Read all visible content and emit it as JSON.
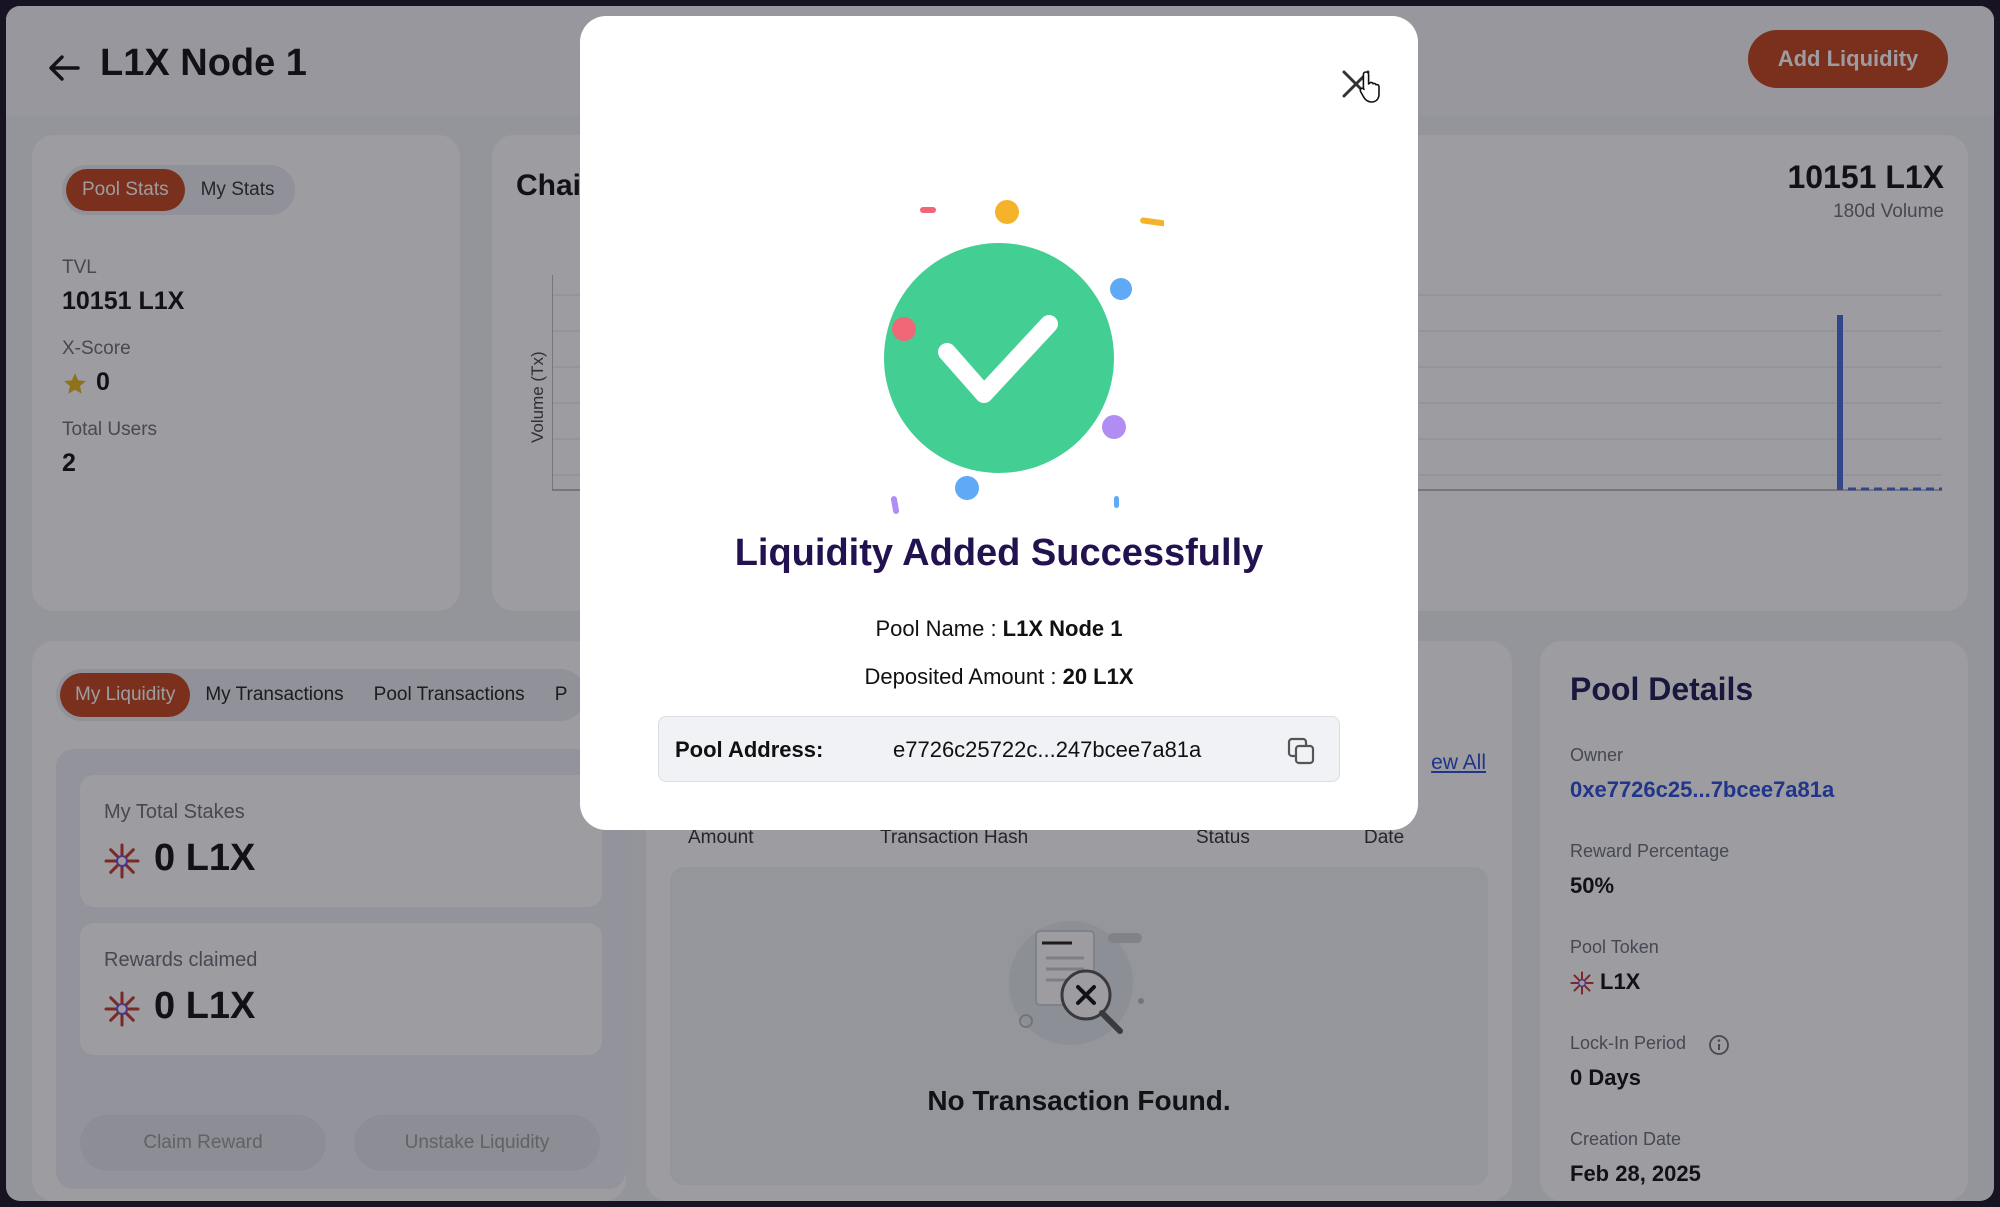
{
  "header": {
    "title": "L1X Node 1",
    "add_liquidity_label": "Add Liquidity"
  },
  "stats": {
    "tabs": [
      "Pool Stats",
      "My Stats"
    ],
    "active_tab": "Pool Stats",
    "tvl_label": "TVL",
    "tvl_value": "10151 L1X",
    "xscore_label": "X-Score",
    "xscore_value": "0",
    "users_label": "Total Users",
    "users_value": "2"
  },
  "chart": {
    "title_partial": "Chai",
    "total_value": "10151 L1X",
    "total_sub": "180d Volume",
    "ylabel": "Volume (Tx)"
  },
  "liquidity": {
    "tabs": [
      "My Liquidity",
      "My Transactions",
      "Pool Transactions",
      "P"
    ],
    "active_tab": "My Liquidity",
    "total_stakes_label": "My Total Stakes",
    "total_stakes_value": "0 L1X",
    "rewards_label": "Rewards claimed",
    "rewards_value": "0 L1X",
    "claim_label": "Claim Reward",
    "unstake_label": "Unstake Liquidity"
  },
  "transactions": {
    "view_all": "ew All",
    "columns": [
      "Amount",
      "Transaction Hash",
      "Status",
      "Date"
    ],
    "empty_text": "No Transaction Found."
  },
  "pool_details": {
    "title": "Pool Details",
    "owner_label": "Owner",
    "owner_value": "0xe7726c25...7bcee7a81a",
    "reward_label": "Reward Percentage",
    "reward_value": "50%",
    "token_label": "Pool Token",
    "token_value": "L1X",
    "lockin_label": "Lock-In Period",
    "lockin_value": "0 Days",
    "creation_label": "Creation Date",
    "creation_value": "Feb 28, 2025"
  },
  "modal": {
    "title": "Liquidity Added Successfully",
    "pool_name_label": "Pool Name : ",
    "pool_name_value": "L1X Node 1",
    "deposit_label": "Deposited Amount : ",
    "deposit_value": "20 L1X",
    "address_label": "Pool Address:",
    "address_value": "e7726c25722c...247bcee7a81a"
  },
  "colors": {
    "accent": "#c5461b",
    "success": "#43cf94",
    "title_dark": "#22124f",
    "link": "#2b4fd8"
  },
  "icons": [
    "back-arrow-icon",
    "star-icon",
    "l1x-token-icon",
    "info-icon",
    "close-icon",
    "copy-icon",
    "check-icon",
    "no-results-icon",
    "pointer-cursor-icon"
  ]
}
